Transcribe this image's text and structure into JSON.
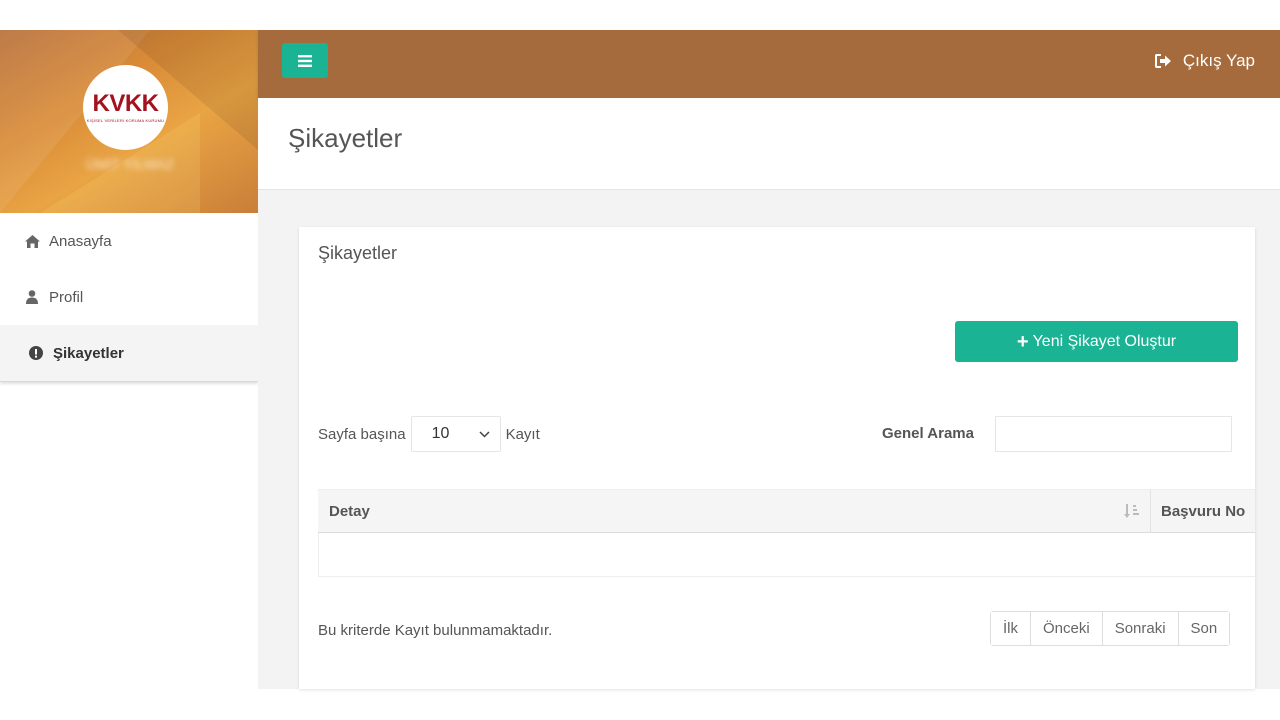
{
  "sidebar": {
    "logo_text": "KVKK",
    "logo_subtitle": "KİŞİSEL VERİLERİ KORUMA KURUMU",
    "user_name": "ÜMİT YILMAZ",
    "items": [
      {
        "label": "Anasayfa",
        "icon": "home-icon"
      },
      {
        "label": "Profil",
        "icon": "user-icon"
      },
      {
        "label": "Şikayetler",
        "icon": "exclamation-circle-icon",
        "active": true
      }
    ]
  },
  "topbar": {
    "logout_label": "Çıkış Yap"
  },
  "page": {
    "title": "Şikayetler"
  },
  "card": {
    "title": "Şikayetler",
    "new_button_label": "Yeni Şikayet Oluştur",
    "perpage_prefix": "Sayfa başına",
    "perpage_value": "10",
    "perpage_suffix": "Kayıt",
    "search_label": "Genel Arama",
    "search_value": ""
  },
  "table": {
    "columns": [
      "Detay",
      "Başvuru No"
    ],
    "empty_message": "Bu kriterde Kayıt bulunmamaktadır."
  },
  "pagination": {
    "first": "İlk",
    "previous": "Önceki",
    "next": "Sonraki",
    "last": "Son"
  },
  "colors": {
    "topbar": "#a66b3c",
    "accent": "#1ab394",
    "logo": "#a3131f"
  }
}
